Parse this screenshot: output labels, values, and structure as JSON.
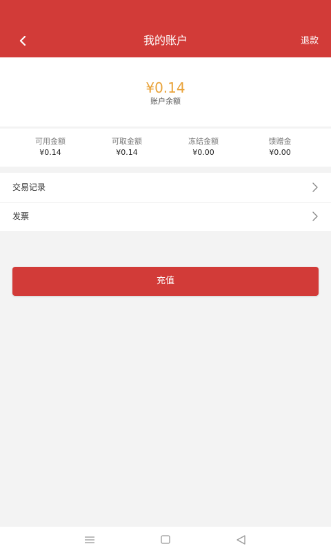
{
  "header": {
    "title": "我的账户",
    "refund_label": "退款",
    "background_color": "#d23b38"
  },
  "balance": {
    "amount": "¥0.14",
    "label": "账户余额",
    "amount_color": "#e9a33a"
  },
  "stats": [
    {
      "label": "可用金额",
      "value": "¥0.14"
    },
    {
      "label": "可取金额",
      "value": "¥0.14"
    },
    {
      "label": "冻结金额",
      "value": "¥0.00"
    },
    {
      "label": "馈赠金",
      "value": "¥0.00"
    }
  ],
  "menu": [
    {
      "label": "交易记录",
      "icon": "chevron-right-icon"
    },
    {
      "label": "发票",
      "icon": "chevron-right-icon"
    }
  ],
  "recharge_button": {
    "label": "充值"
  },
  "system_nav": {
    "icons": [
      "menu-icon",
      "home-square-icon",
      "back-triangle-icon"
    ]
  }
}
